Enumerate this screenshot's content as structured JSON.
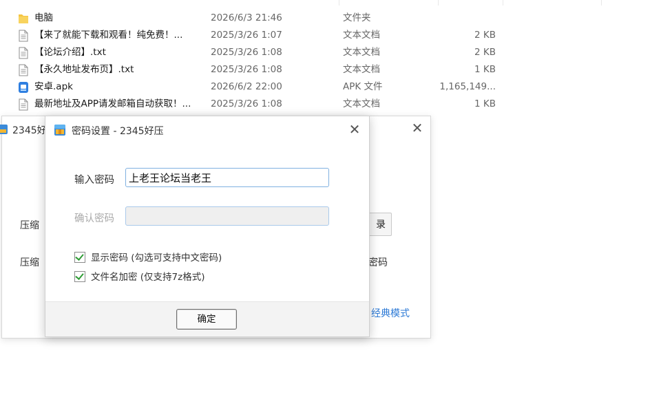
{
  "files": [
    {
      "icon": "folder-icon",
      "name": "电脑",
      "date": "2026/6/3 21:46",
      "type": "文件夹",
      "size": ""
    },
    {
      "icon": "text-file-icon",
      "name": "【来了就能下载和观看！纯免费！...",
      "date": "2025/3/26 1:07",
      "type": "文本文档",
      "size": "2 KB"
    },
    {
      "icon": "text-file-icon",
      "name": "【论坛介绍】.txt",
      "date": "2025/3/26 1:08",
      "type": "文本文档",
      "size": "2 KB"
    },
    {
      "icon": "text-file-icon",
      "name": "【永久地址发布页】.txt",
      "date": "2025/3/26 1:08",
      "type": "文本文档",
      "size": "1 KB"
    },
    {
      "icon": "apk-icon",
      "name": "安卓.apk",
      "date": "2026/6/2 22:00",
      "type": "APK 文件",
      "size": "1,165,149..."
    },
    {
      "icon": "text-file-icon",
      "name": "最新地址及APP请发邮箱自动获取！...",
      "date": "2025/3/26 1:08",
      "type": "文本文档",
      "size": "1 KB"
    }
  ],
  "back_dialog": {
    "title": "2345好",
    "close": "✕",
    "label_compress_1": "压缩",
    "label_compress_2": "压缩",
    "browse_label": "录",
    "password_text": "密码",
    "classic_mode": "经典模式"
  },
  "dialog": {
    "title": "密码设置 - 2345好压",
    "close": "✕",
    "enter_password_label": "输入密码",
    "enter_password_value": "上老王论坛当老王",
    "confirm_password_label": "确认密码",
    "confirm_password_value": "",
    "show_password_label": "显示密码 (勾选可支持中文密码)",
    "show_password_checked": true,
    "encrypt_filenames_label": "文件名加密 (仅支持7z格式)",
    "encrypt_filenames_checked": true,
    "ok_label": "确定"
  },
  "colors": {
    "folder": "#f5c542",
    "apk": "#2f7fe0",
    "accent_link": "#2d7ad6",
    "check": "#2e9b34"
  }
}
